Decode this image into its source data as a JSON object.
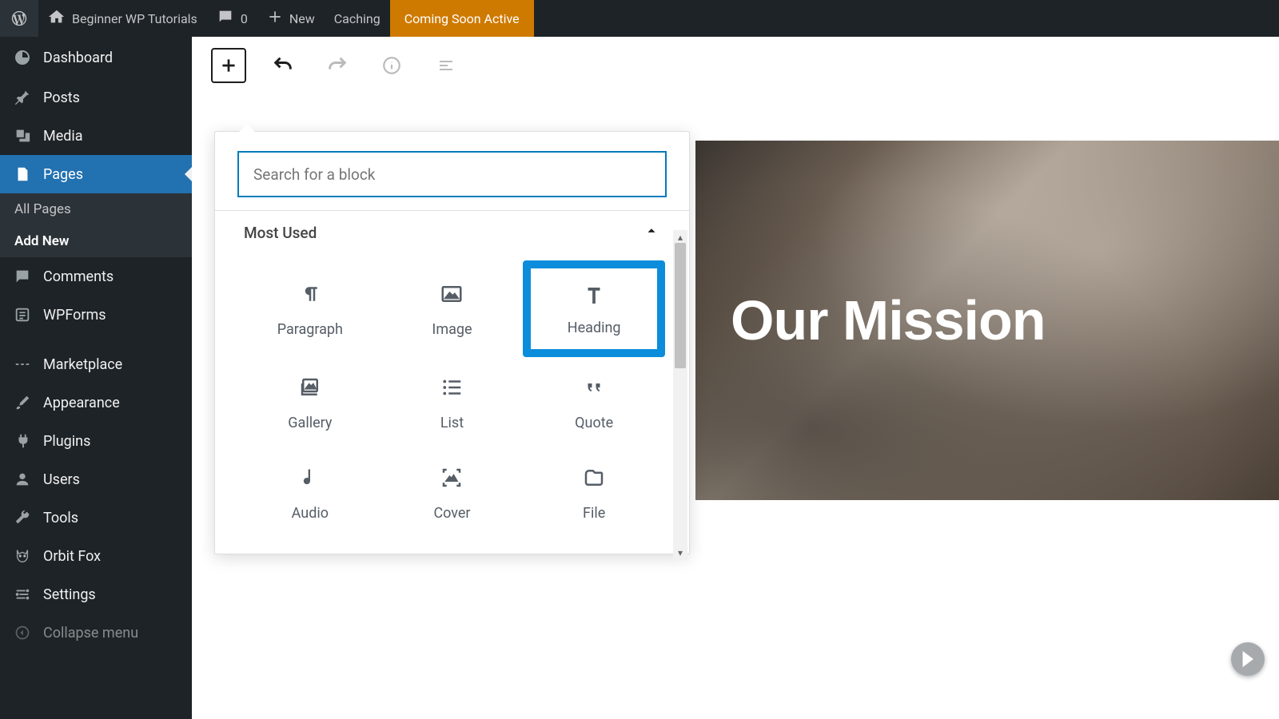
{
  "admin_bar": {
    "site_name": "Beginner WP Tutorials",
    "comments_count": "0",
    "new_label": "New",
    "caching_label": "Caching",
    "coming_soon": "Coming Soon Active"
  },
  "sidebar": {
    "items": [
      {
        "label": "Dashboard",
        "icon": "dashboard-icon"
      },
      {
        "label": "Posts",
        "icon": "pin-icon"
      },
      {
        "label": "Media",
        "icon": "media-icon"
      },
      {
        "label": "Pages",
        "icon": "page-icon",
        "active": true,
        "submenu": [
          {
            "label": "All Pages"
          },
          {
            "label": "Add New",
            "current": true
          }
        ]
      },
      {
        "label": "Comments",
        "icon": "comment-icon"
      },
      {
        "label": "WPForms",
        "icon": "form-icon"
      },
      {
        "label": "Marketplace",
        "icon": "market-icon"
      },
      {
        "label": "Appearance",
        "icon": "brush-icon"
      },
      {
        "label": "Plugins",
        "icon": "plug-icon"
      },
      {
        "label": "Users",
        "icon": "user-icon"
      },
      {
        "label": "Tools",
        "icon": "wrench-icon"
      },
      {
        "label": "Orbit Fox",
        "icon": "fox-icon"
      },
      {
        "label": "Settings",
        "icon": "settings-icon"
      },
      {
        "label": "Collapse menu",
        "icon": "collapse-icon"
      }
    ]
  },
  "inserter": {
    "search_placeholder": "Search for a block",
    "category": "Most Used",
    "blocks": [
      {
        "label": "Paragraph",
        "icon": "paragraph-icon"
      },
      {
        "label": "Image",
        "icon": "image-icon"
      },
      {
        "label": "Heading",
        "icon": "heading-icon",
        "highlighted": true
      },
      {
        "label": "Gallery",
        "icon": "gallery-icon"
      },
      {
        "label": "List",
        "icon": "list-icon"
      },
      {
        "label": "Quote",
        "icon": "quote-icon"
      },
      {
        "label": "Audio",
        "icon": "audio-icon"
      },
      {
        "label": "Cover",
        "icon": "cover-icon"
      },
      {
        "label": "File",
        "icon": "file-icon"
      }
    ]
  },
  "page": {
    "hero_title": "Our Mission"
  }
}
